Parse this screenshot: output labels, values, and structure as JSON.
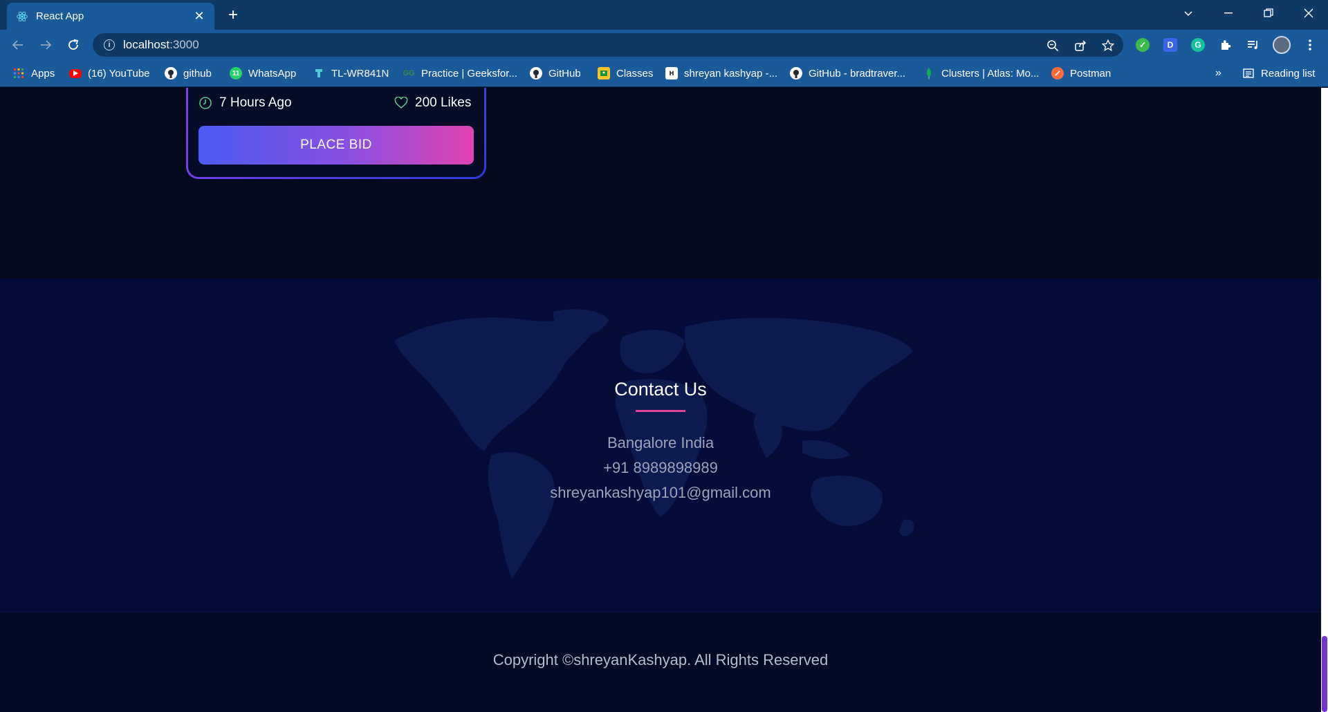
{
  "browser": {
    "tab_title": "React App",
    "url_host": "localhost",
    "url_port": ":3000",
    "bookmarks": [
      {
        "label": "Apps",
        "icon": "apps-grid-icon"
      },
      {
        "label": "(16) YouTube",
        "icon": "youtube-icon"
      },
      {
        "label": "github",
        "icon": "github-icon"
      },
      {
        "label": "WhatsApp",
        "icon": "whatsapp-icon"
      },
      {
        "label": "TL-WR841N",
        "icon": "tplink-icon"
      },
      {
        "label": "Practice | Geeksfor...",
        "icon": "geeksforgeeks-icon"
      },
      {
        "label": "GitHub",
        "icon": "github-icon"
      },
      {
        "label": "Classes",
        "icon": "classroom-icon"
      },
      {
        "label": "shreyan kashyap -...",
        "icon": "hackerrank-icon"
      },
      {
        "label": "GitHub - bradtraver...",
        "icon": "github-icon"
      },
      {
        "label": "Clusters | Atlas: Mo...",
        "icon": "mongodb-icon"
      },
      {
        "label": "Postman",
        "icon": "postman-icon"
      }
    ],
    "overflow_label": "»",
    "reading_list_label": "Reading list"
  },
  "card": {
    "time_ago": "7 Hours Ago",
    "likes": "200 Likes",
    "bid_button": "PLACE BID"
  },
  "contact": {
    "title": "Contact Us",
    "location": "Bangalore India",
    "phone": "+91 8989898989",
    "email": "shreyankashyap101@gmail.com"
  },
  "footer": {
    "copyright": "Copyright ©shreyanKashyap. All Rights Reserved"
  },
  "colors": {
    "accent_pink": "#e0449a",
    "accent_blue": "#4b5cf5",
    "page_bg": "#050a1f"
  }
}
